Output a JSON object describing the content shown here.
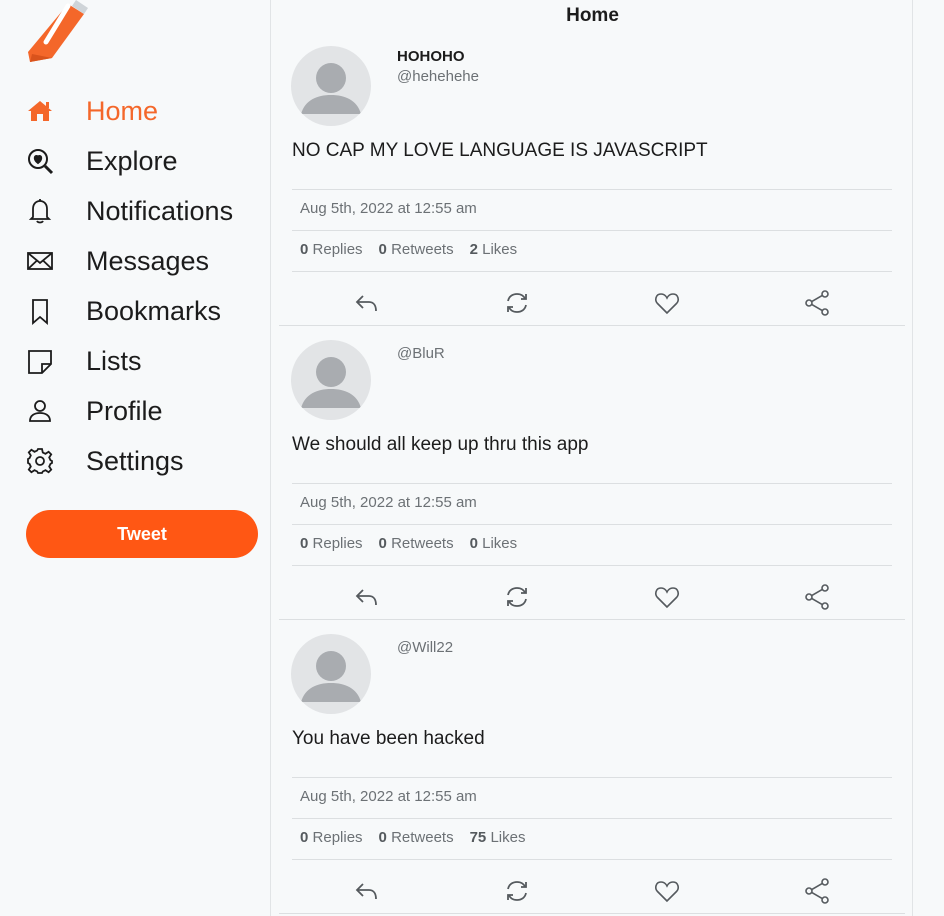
{
  "colors": {
    "accent": "#f4672a",
    "button": "#ff5714",
    "muted": "#6c7175"
  },
  "sidebar": {
    "logo_icon": "pen-logo-icon",
    "items": [
      {
        "label": "Home",
        "icon": "home-icon",
        "active": true
      },
      {
        "label": "Explore",
        "icon": "explore-icon"
      },
      {
        "label": "Notifications",
        "icon": "bell-icon"
      },
      {
        "label": "Messages",
        "icon": "mail-icon"
      },
      {
        "label": "Bookmarks",
        "icon": "bookmark-icon"
      },
      {
        "label": "Lists",
        "icon": "list-note-icon"
      },
      {
        "label": "Profile",
        "icon": "user-icon"
      },
      {
        "label": "Settings",
        "icon": "gear-icon"
      }
    ],
    "tweet_label": "Tweet"
  },
  "feed": {
    "title": "Home",
    "posts": [
      {
        "name": "HOHOHO",
        "handle": "@hehehehe",
        "text": "NO CAP MY LOVE LANGUAGE IS JAVASCRIPT",
        "date": "Aug 5th, 2022 at 12:55 am",
        "replies": "0",
        "replies_label": "Replies",
        "retweets": "0",
        "retweets_label": "Retweets",
        "likes": "2",
        "likes_label": "Likes"
      },
      {
        "name": "",
        "handle": "@BluR",
        "text": "We should all keep up thru this app",
        "date": "Aug 5th, 2022 at 12:55 am",
        "replies": "0",
        "replies_label": "Replies",
        "retweets": "0",
        "retweets_label": "Retweets",
        "likes": "0",
        "likes_label": "Likes"
      },
      {
        "name": "",
        "handle": "@Will22",
        "text": "You have been hacked",
        "date": "Aug 5th, 2022 at 12:55 am",
        "replies": "0",
        "replies_label": "Replies",
        "retweets": "0",
        "retweets_label": "Retweets",
        "likes": "75",
        "likes_label": "Likes"
      }
    ]
  }
}
